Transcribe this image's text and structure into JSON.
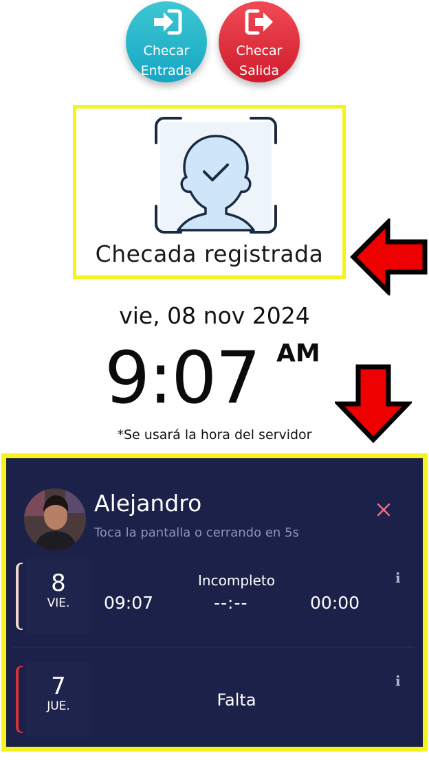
{
  "buttons": {
    "check_in": {
      "line1": "Checar",
      "line2": "Entrada",
      "color": "#1fb3c9"
    },
    "check_out": {
      "line1": "Checar",
      "line2": "Salida",
      "color": "#e0263a"
    }
  },
  "status": {
    "text": "Checada registrada"
  },
  "date": {
    "text": "vie, 08 nov 2024"
  },
  "clock": {
    "time": "9:07",
    "ampm": "AM"
  },
  "server_note": "*Se usará la hora del servidor",
  "panel": {
    "user_name": "Alejandro",
    "countdown": "Toca la pantalla o cerrando en 5s",
    "records": [
      {
        "day": "8",
        "weekday": "VIE.",
        "status": "Incompleto",
        "time_in": "09:07",
        "time_out": "--:--",
        "total": "00:00",
        "accent_color": "#f3d6d2"
      },
      {
        "day": "7",
        "weekday": "JUE.",
        "status": "Falta",
        "accent_color": "#d9313a"
      }
    ]
  },
  "colors": {
    "highlight": "#f5f21c",
    "panel_bg": "#1b2148",
    "arrow": "#ee0000"
  }
}
